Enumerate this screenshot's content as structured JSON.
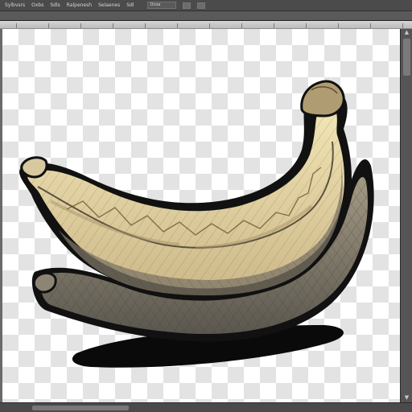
{
  "menubar": {
    "items": [
      "Sylbvsrs",
      "Oxbs",
      "Sdls",
      "Ralpenesh",
      "Selaenes",
      "Sdl"
    ],
    "field_text": "Ocoa"
  },
  "canvas": {
    "background": "transparency-checkerboard",
    "artwork": "banana-illustration"
  },
  "colors": {
    "ui_dark": "#4b4b4b",
    "ruler": "#cfcfcf",
    "checker_light": "#ffffff",
    "checker_dark": "#e3e3e3",
    "banana_skin": "#e9d9a3",
    "banana_shadow": "#6e6a60"
  }
}
